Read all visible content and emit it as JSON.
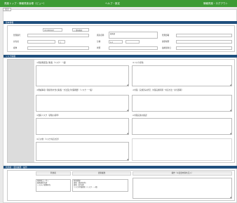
{
  "header": {
    "left_title": "資産トップ・情報資産台帳（ビュー）",
    "center_title": "ヘルプ・設定",
    "right_title": "情報資産・ログアウト"
  },
  "nav": {
    "back_label": "戻る"
  },
  "basic_section": {
    "title": "基本情報",
    "asset_id_label": "管理番号",
    "asset_id_value": "ID 0000123",
    "asset_type_value": "○ 情報資産",
    "name_label": "資産名称",
    "owner_label": "管理部署",
    "owner_value": "総務部",
    "holder_label": "担当者",
    "category_label": "分類",
    "category_value": "□",
    "storage_label": "保管場所",
    "storage_value": "A-1",
    "medium_label": "媒体",
    "status_label": "状態",
    "updated_label": "最終更新日"
  },
  "detail_section": {
    "title": "リスク情報",
    "q1_label": "①資産概要及び取扱（リスク・一般）",
    "q2_label": "②リスク評価",
    "q3_label": "③脅威事項（脆弱性を含む取扱・方法及び対策概要）（リスク・一般）",
    "q4_label": "④対策（実施済み状況、対策実施時期・対応方法・担当部署）",
    "q5_label": "⑤残存リスク（評価の基準）",
    "q6_label": "⑥対策実施の確認",
    "q7_label": "⑦その他（リスク対応方針）"
  },
  "history_section": {
    "title": "利用者・更新履歴・操作",
    "col_user": "利用者",
    "col_history": "更新履歴",
    "col_operation": "操作（※変更内容を記入）",
    "users": [
      "管理者ユーザー",
      "総務部担当者",
      "システム管理担当"
    ],
    "history": [
      "新規登録",
      "更新（資産名称）",
      "更新（担当者）",
      "リスク評価更新（リスク・一般）"
    ]
  }
}
